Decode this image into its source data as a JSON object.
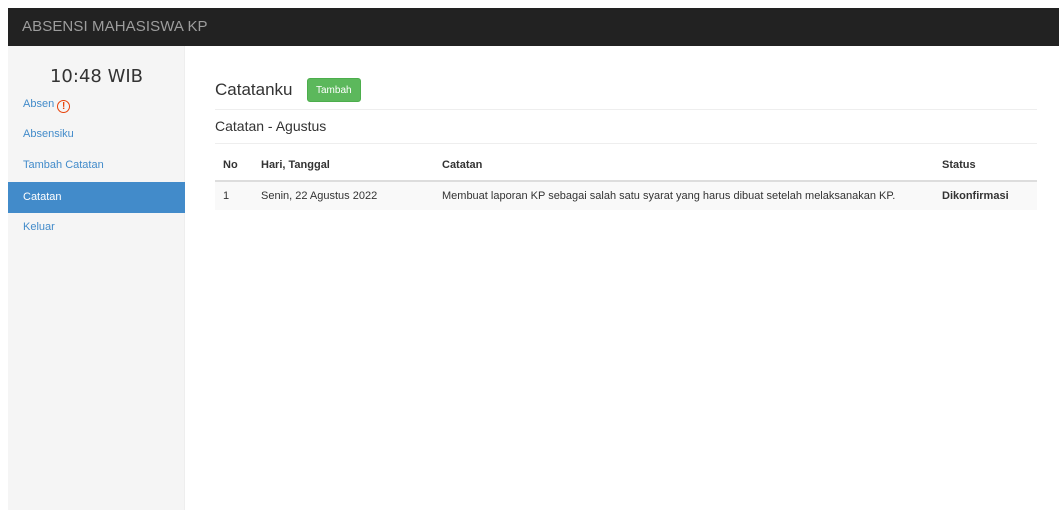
{
  "navbar": {
    "brand": "ABSENSI MAHASISWA KP"
  },
  "sidebar": {
    "clock": "10:48 WIB",
    "items": [
      {
        "label": "Absen",
        "icon": "alert-circle-icon",
        "active": false
      },
      {
        "label": "Absensiku",
        "active": false
      },
      {
        "label": "Tambah Catatan",
        "active": false
      },
      {
        "label": "Catatan",
        "active": true
      },
      {
        "label": "Keluar",
        "active": false
      }
    ]
  },
  "main": {
    "title": "Catatanku",
    "add_button": "Tambah",
    "section_title": "Catatan - Agustus",
    "table": {
      "headers": [
        "No",
        "Hari, Tanggal",
        "Catatan",
        "Status"
      ],
      "rows": [
        [
          "1",
          "Senin, 22 Agustus 2022",
          "Membuat laporan KP sebagai salah satu syarat yang harus dibuat setelah melaksanakan KP.",
          "Dikonfirmasi"
        ]
      ]
    }
  },
  "colors": {
    "navbar_bg": "#222222",
    "accent": "#428bca",
    "success": "#5cb85c",
    "alert": "#e8420a"
  }
}
